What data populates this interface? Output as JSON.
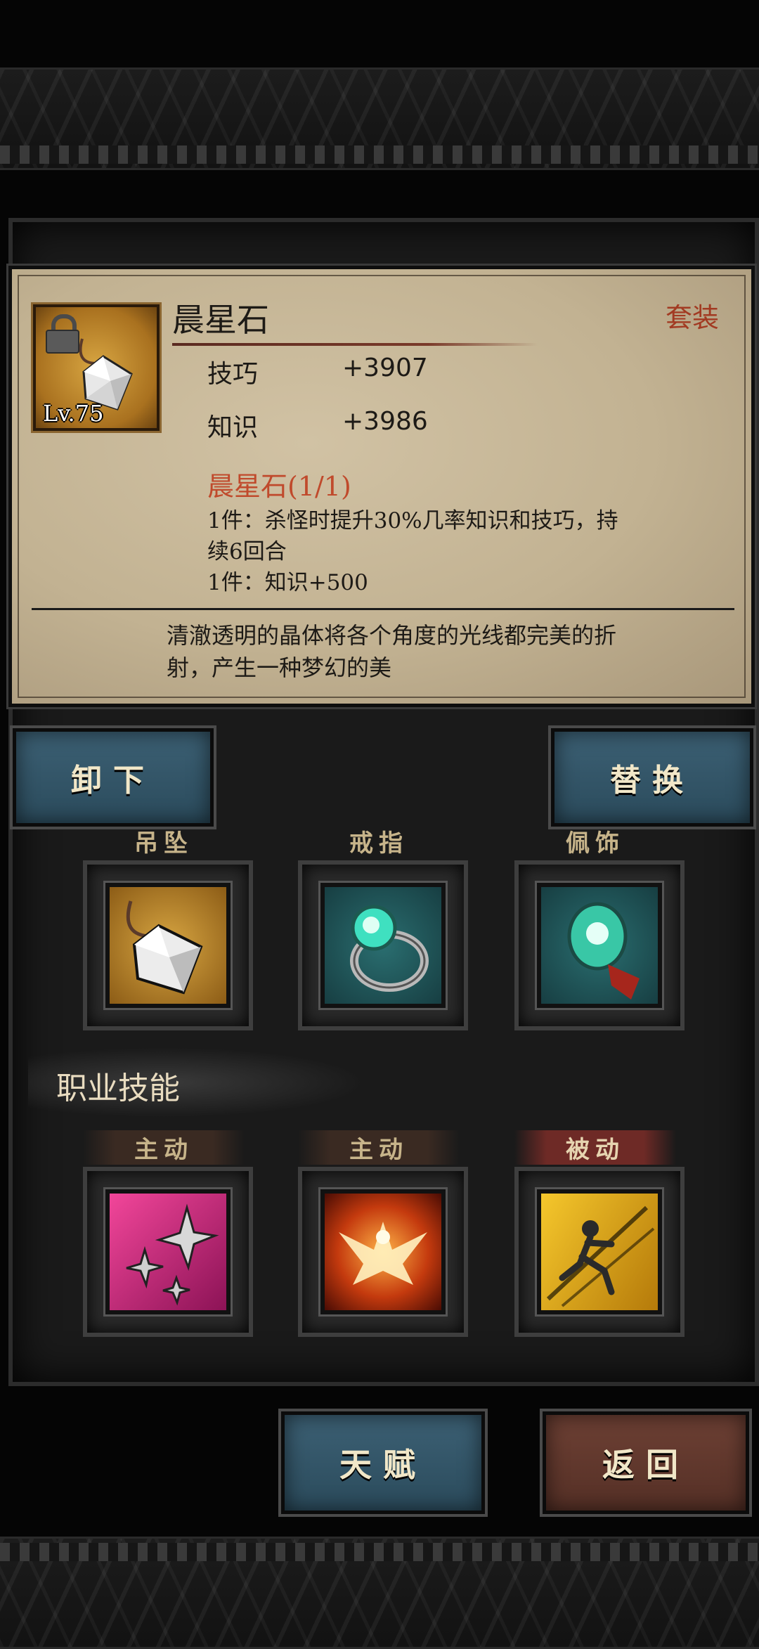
{
  "item": {
    "name": "晨星石",
    "set_tag": "套装",
    "level": "Lv.75",
    "stats": [
      {
        "label": "技巧",
        "value": "+3907"
      },
      {
        "label": "知识",
        "value": "+3986"
      }
    ],
    "set": {
      "title": "晨星石(1/1)",
      "effect_1a": "1件：杀怪时提升30%几率知识和技巧，持",
      "effect_1b": "续6回合",
      "effect_2": "1件：知识+500"
    },
    "flavor_a": "清澈透明的晶体将各个角度的光线都完美的折",
    "flavor_b": "射，产生一种梦幻的美"
  },
  "actions": {
    "unequip": "卸下",
    "replace": "替换"
  },
  "equipment": [
    {
      "label": "吊坠",
      "icon": "crystal-pendant-icon"
    },
    {
      "label": "戒指",
      "icon": "emerald-ring-icon"
    },
    {
      "label": "佩饰",
      "icon": "jade-tassel-icon"
    }
  ],
  "skills_title": "职业技能",
  "skills": [
    {
      "label": "主动",
      "icon": "shuriken-icon"
    },
    {
      "label": "主动",
      "icon": "phoenix-icon"
    },
    {
      "label": "被动",
      "icon": "ninja-dash-icon"
    }
  ],
  "footer": {
    "talent": "天赋",
    "back": "返回"
  },
  "colors": {
    "parchment": "#c2b292",
    "accent_red": "#a23a22",
    "button_blue": "#2b4b5c",
    "button_red": "#553026"
  }
}
